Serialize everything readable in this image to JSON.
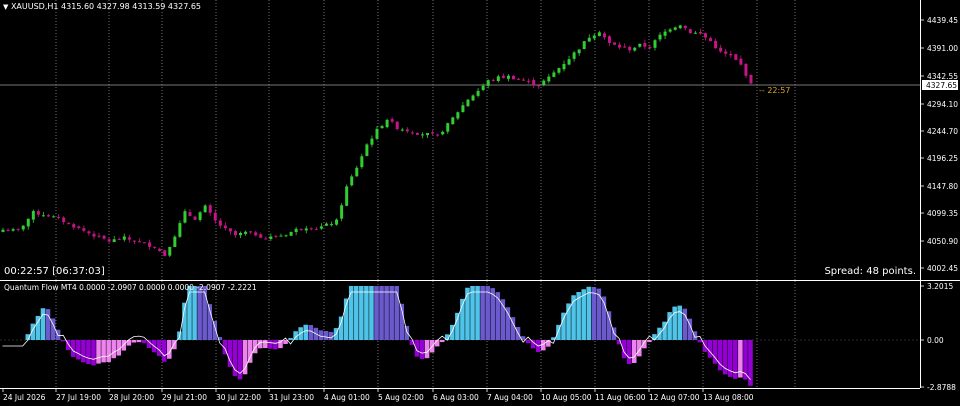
{
  "header": {
    "symbol": "XAUUSD,H1",
    "ohlc": "4315.60 4327.98 4313.59 4327.65"
  },
  "price_axis": {
    "labels": [
      "4439.45",
      "4391.00",
      "4342.55",
      "4294.10",
      "4244.70",
      "4196.25",
      "4147.80",
      "4099.35",
      "4050.90",
      "4002.45"
    ],
    "current_price": "4327.65"
  },
  "timer_main": "00:22:57 [06:37:03]",
  "bar_countdown": "-- 22:57",
  "spread_text": "Spread: 48 points.",
  "indicator": {
    "title": "Quantum Flow MT4 0.0000 -2.0907 0.0000 0.0000 -2.0907 -2.2221",
    "axis_labels": [
      "3.2015",
      "0.00",
      "-2.8788"
    ]
  },
  "time_axis": {
    "labels": [
      "24 Jul 2026",
      "27 Jul 19:00",
      "28 Jul 20:00",
      "29 Jul 21:00",
      "30 Jul 22:00",
      "31 Jul 23:00",
      "4 Aug 01:00",
      "5 Aug 02:00",
      "6 Aug 03:00",
      "7 Aug 04:00",
      "10 Aug 05:00",
      "11 Aug 06:00",
      "12 Aug 07:00",
      "13 Aug 08:00"
    ]
  },
  "colors": {
    "background": "#000000",
    "bull_candle": "#32cd32",
    "bear_candle": "#c71585",
    "hist_positive": "#4fc3e8",
    "hist_positive_fade": "#6a5acd",
    "hist_negative": "#9400d3",
    "hist_negative_fade": "#ee82ee",
    "signal_line": "#ffffff",
    "countdown": "#daa520"
  },
  "chart_data": {
    "type": "candlestick",
    "symbol": "XAUUSD,H1",
    "last_price": 4327.65,
    "ylim": [
      4002.45,
      4439.45
    ],
    "close_path": [
      [
        0,
        4070
      ],
      [
        3,
        4068
      ],
      [
        6,
        4100
      ],
      [
        9,
        4095
      ],
      [
        12,
        4085
      ],
      [
        15,
        4072
      ],
      [
        18,
        4060
      ],
      [
        21,
        4050
      ],
      [
        24,
        4055
      ],
      [
        27,
        4048
      ],
      [
        30,
        4040
      ],
      [
        32,
        4025
      ],
      [
        34,
        4060
      ],
      [
        36,
        4100
      ],
      [
        38,
        4090
      ],
      [
        40,
        4110
      ],
      [
        42,
        4085
      ],
      [
        44,
        4070
      ],
      [
        46,
        4060
      ],
      [
        48,
        4065
      ],
      [
        50,
        4062
      ],
      [
        52,
        4055
      ],
      [
        54,
        4058
      ],
      [
        56,
        4062
      ],
      [
        58,
        4070
      ],
      [
        60,
        4075
      ],
      [
        62,
        4072
      ],
      [
        64,
        4078
      ],
      [
        66,
        4085
      ],
      [
        68,
        4145
      ],
      [
        70,
        4180
      ],
      [
        72,
        4220
      ],
      [
        74,
        4245
      ],
      [
        76,
        4265
      ],
      [
        78,
        4250
      ],
      [
        80,
        4245
      ],
      [
        82,
        4240
      ],
      [
        84,
        4238
      ],
      [
        86,
        4235
      ],
      [
        88,
        4255
      ],
      [
        90,
        4278
      ],
      [
        92,
        4300
      ],
      [
        94,
        4315
      ],
      [
        96,
        4332
      ],
      [
        98,
        4338
      ],
      [
        100,
        4340
      ],
      [
        102,
        4335
      ],
      [
        104,
        4330
      ],
      [
        106,
        4325
      ],
      [
        108,
        4338
      ],
      [
        110,
        4355
      ],
      [
        112,
        4372
      ],
      [
        114,
        4390
      ],
      [
        116,
        4410
      ],
      [
        118,
        4420
      ],
      [
        120,
        4398
      ],
      [
        122,
        4392
      ],
      [
        124,
        4388
      ],
      [
        126,
        4395
      ],
      [
        128,
        4392
      ],
      [
        130,
        4412
      ],
      [
        132,
        4425
      ],
      [
        134,
        4432
      ],
      [
        136,
        4418
      ],
      [
        138,
        4415
      ],
      [
        140,
        4402
      ],
      [
        142,
        4382
      ],
      [
        144,
        4376
      ],
      [
        146,
        4360
      ],
      [
        148,
        4327.65
      ]
    ]
  }
}
